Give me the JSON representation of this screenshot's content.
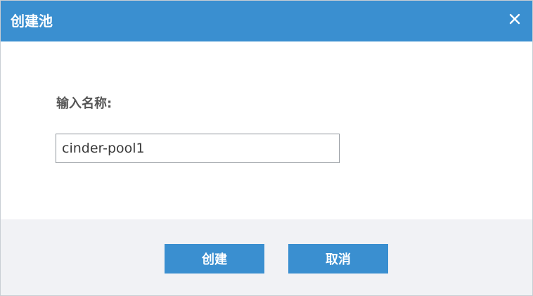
{
  "dialog": {
    "title": "创建池",
    "close_icon": "close-icon",
    "field_label": "输入名称:",
    "name_input": {
      "value": "cinder-pool1",
      "placeholder": ""
    },
    "buttons": {
      "create_label": "创建",
      "cancel_label": "取消"
    }
  },
  "colors": {
    "title_bar": "#3a8fd0",
    "button": "#3a8fd0",
    "footer": "#f1f2f5"
  }
}
